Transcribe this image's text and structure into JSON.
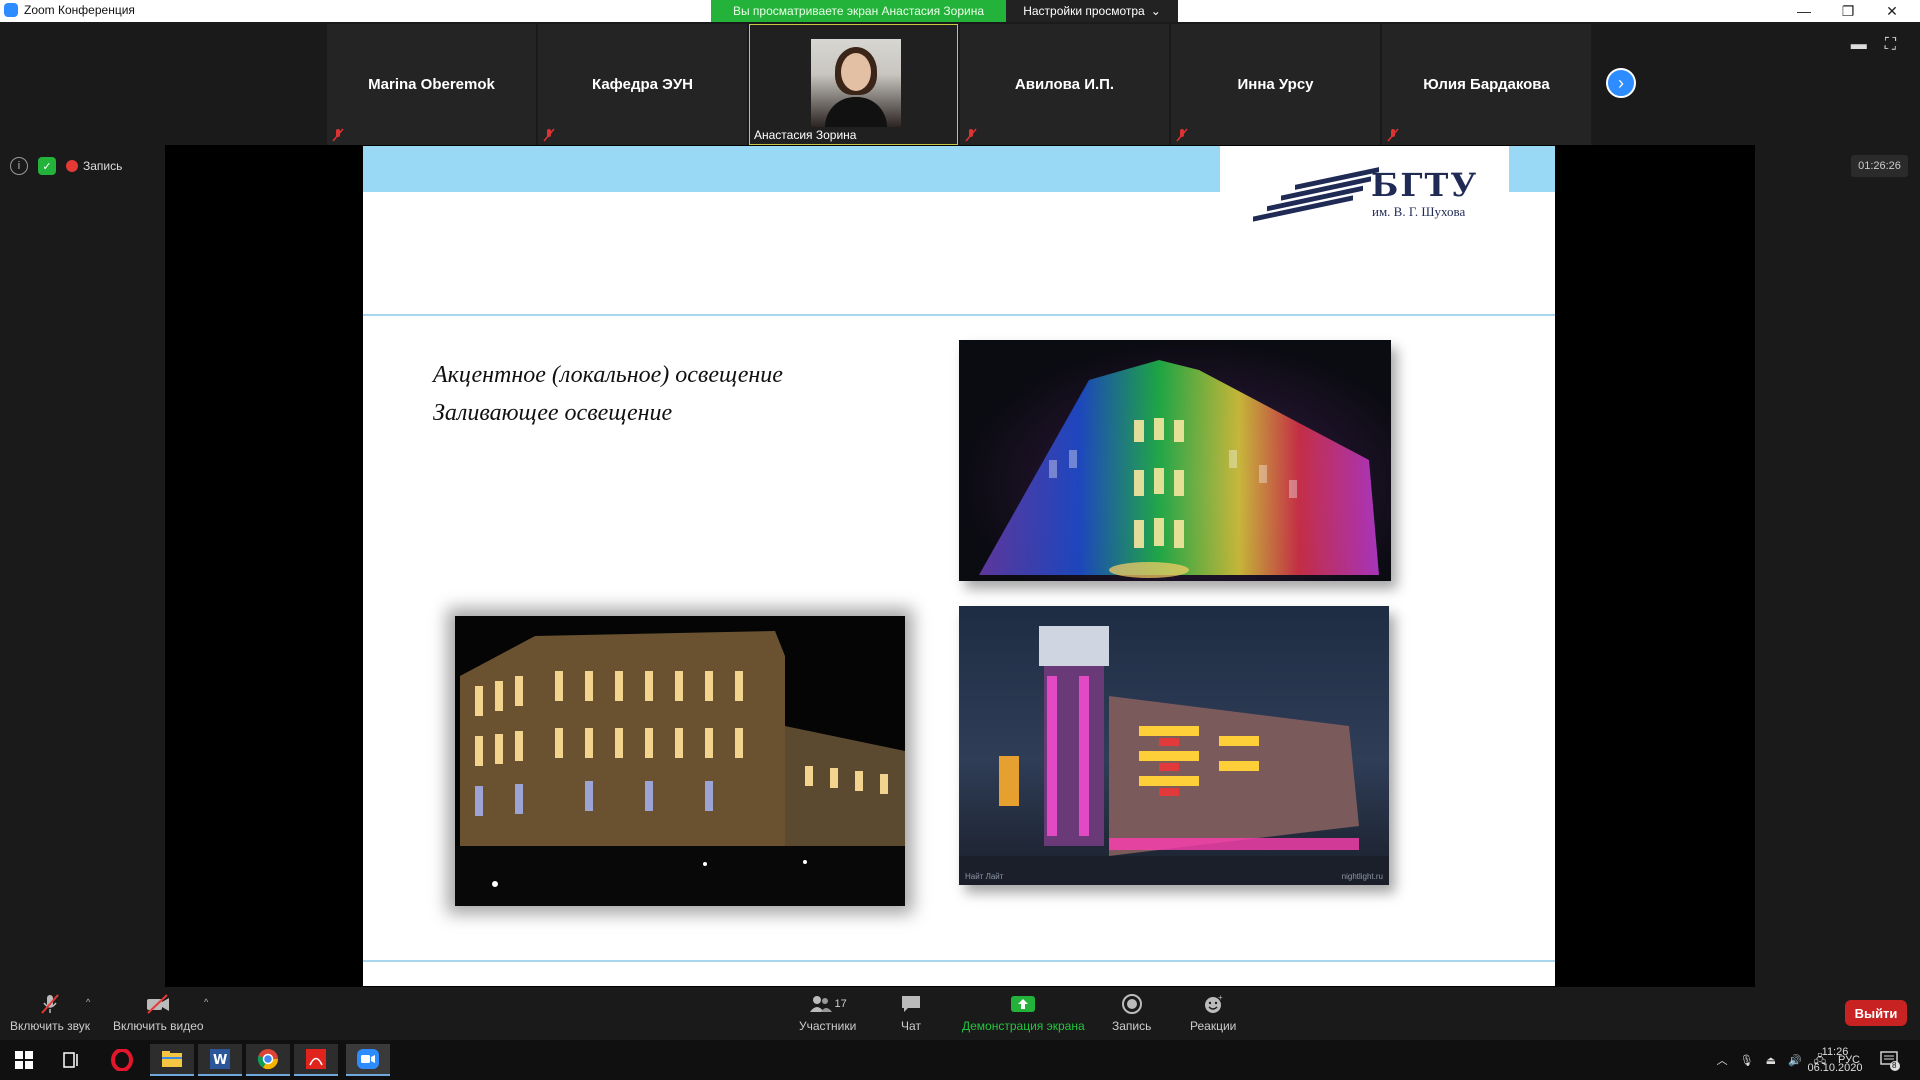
{
  "window": {
    "title": "Zoom Конференция",
    "sharing_banner": "Вы просматриваете экран Анастасия Зорина",
    "view_settings": "Настройки просмотра"
  },
  "gallery": [
    {
      "name": "Marina Oberemok",
      "muted": true
    },
    {
      "name": "Кафедра ЭУН",
      "muted": true
    },
    {
      "name": "Анастасия Зорина",
      "muted": false,
      "video": true,
      "active": true
    },
    {
      "name": "Авилова И.П.",
      "muted": true
    },
    {
      "name": "Инна Урсу",
      "muted": true
    },
    {
      "name": "Юлия Бардакова",
      "muted": true
    }
  ],
  "infobar": {
    "record_label": "Запись"
  },
  "timer": "01:26:26",
  "slide": {
    "logo_word": "БГТУ",
    "logo_sub": "им. В. Г. Шухова",
    "bullets": [
      "Акцентное (локальное) освещение",
      "Заливающее освещение"
    ],
    "image_caption_left": "Найт Лайт",
    "image_caption_right": "nightlight.ru"
  },
  "toolbar": {
    "unmute": "Включить звук",
    "start_video": "Включить видео",
    "participants": "Участники",
    "participants_count": "17",
    "chat": "Чат",
    "share_screen": "Демонстрация экрана",
    "record": "Запись",
    "reactions": "Реакции",
    "leave": "Выйти"
  },
  "taskbar": {
    "lang": "РУС",
    "time": "11:26",
    "date": "06.10.2020",
    "notifications": "8"
  },
  "colors": {
    "zoom_blue": "#2d8cff",
    "share_green": "#23b33b",
    "leave_red": "#c92222",
    "slide_band": "#99d9f5"
  }
}
